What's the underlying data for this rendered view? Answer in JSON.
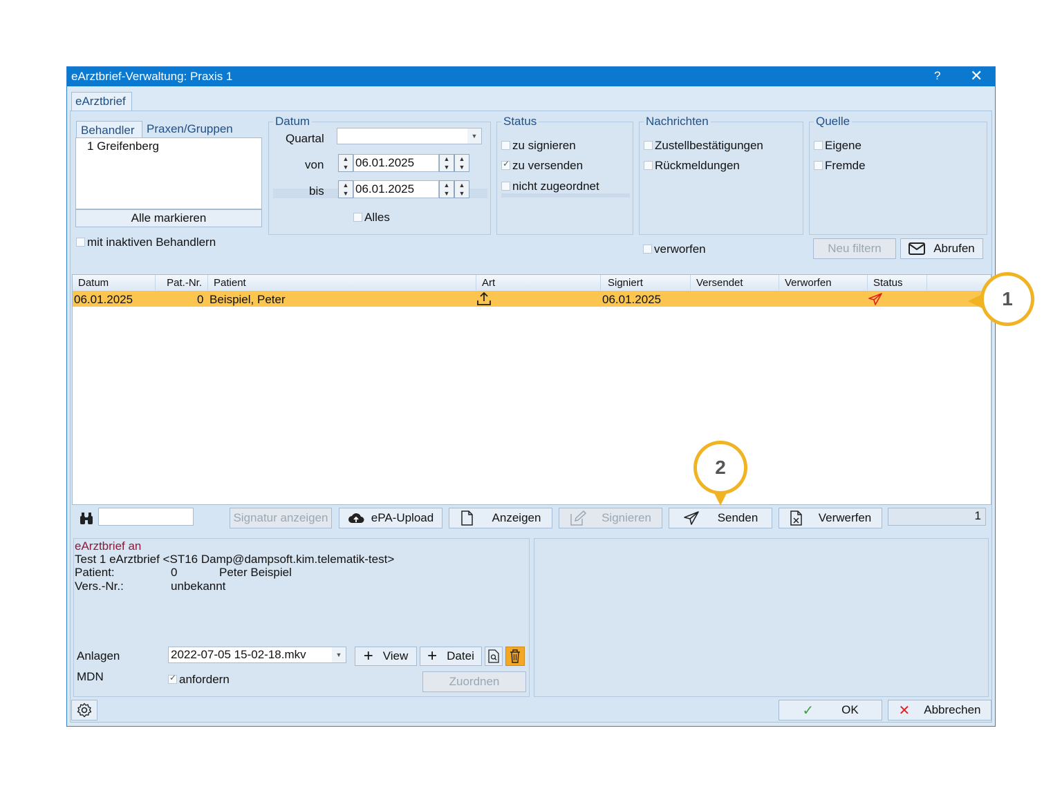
{
  "window": {
    "title": "eArztbrief-Verwaltung: Praxis 1",
    "help": "?",
    "close": "✕"
  },
  "main_tab": "eArztbrief",
  "behandler": {
    "tabs": [
      "Behandler",
      "Praxen/Gruppen"
    ],
    "items": [
      "1 Greifenberg"
    ],
    "mark_all": "Alle markieren",
    "inactive": "mit inaktiven Behandlern"
  },
  "datum": {
    "title": "Datum",
    "quartal_label": "Quartal",
    "quartal_value": "",
    "von_label": "von",
    "von_value": "06.01.2025",
    "bis_label": "bis",
    "bis_value": "06.01.2025",
    "alles": "Alles"
  },
  "status": {
    "title": "Status",
    "options": [
      {
        "label": "zu signieren",
        "checked": false
      },
      {
        "label": "zu versenden",
        "checked": true
      },
      {
        "label": "nicht zugeordnet",
        "checked": false
      }
    ]
  },
  "nachrichten": {
    "title": "Nachrichten",
    "options": [
      {
        "label": "Zustellbestätigungen",
        "checked": false
      },
      {
        "label": "Rückmeldungen",
        "checked": false
      }
    ],
    "verworfen": "verworfen"
  },
  "quelle": {
    "title": "Quelle",
    "options": [
      {
        "label": "Eigene",
        "checked": false
      },
      {
        "label": "Fremde",
        "checked": false
      }
    ]
  },
  "filter_buttons": {
    "neu_filtern": "Neu filtern",
    "abrufen": "Abrufen"
  },
  "table": {
    "columns": [
      "Datum",
      "Pat.-Nr.",
      "Patient",
      "Art",
      "Signiert",
      "Versendet",
      "Verworfen",
      "Status"
    ],
    "rows": [
      {
        "datum": "06.01.2025",
        "pat_nr": "0",
        "patient": "Beispiel, Peter",
        "art_icon": "upload-icon",
        "signiert": "06.01.2025",
        "versendet": "",
        "verworfen": "",
        "status_icon": "send-icon"
      }
    ]
  },
  "toolbar": {
    "search_value": "",
    "signatur": "Signatur anzeigen",
    "epa": "ePA-Upload",
    "anzeigen": "Anzeigen",
    "signieren": "Signieren",
    "senden": "Senden",
    "verwerfen": "Verwerfen",
    "count": "1"
  },
  "detail": {
    "heading": "eArztbrief an",
    "recipient": "Test 1 eArztbrief <ST16 Damp@dampsoft.kim.telematik-test>",
    "patient_label": "Patient:",
    "patient_nr": "0",
    "patient_name": "Peter Beispiel",
    "vers_label": "Vers.-Nr.:",
    "vers_value": "unbekannt",
    "anlagen_label": "Anlagen",
    "anlagen_value": "2022-07-05 15-02-18.mkv",
    "view": "View",
    "datei": "Datei",
    "mdn_label": "MDN",
    "mdn_option": "anfordern",
    "zuordnen": "Zuordnen"
  },
  "footer": {
    "ok": "OK",
    "abbrechen": "Abbrechen"
  },
  "callouts": [
    "1",
    "2"
  ],
  "colors": {
    "titlebar": "#0b79d0",
    "selected_row": "#fbc54f",
    "callout": "#f0b323",
    "status_red": "#e02020"
  }
}
